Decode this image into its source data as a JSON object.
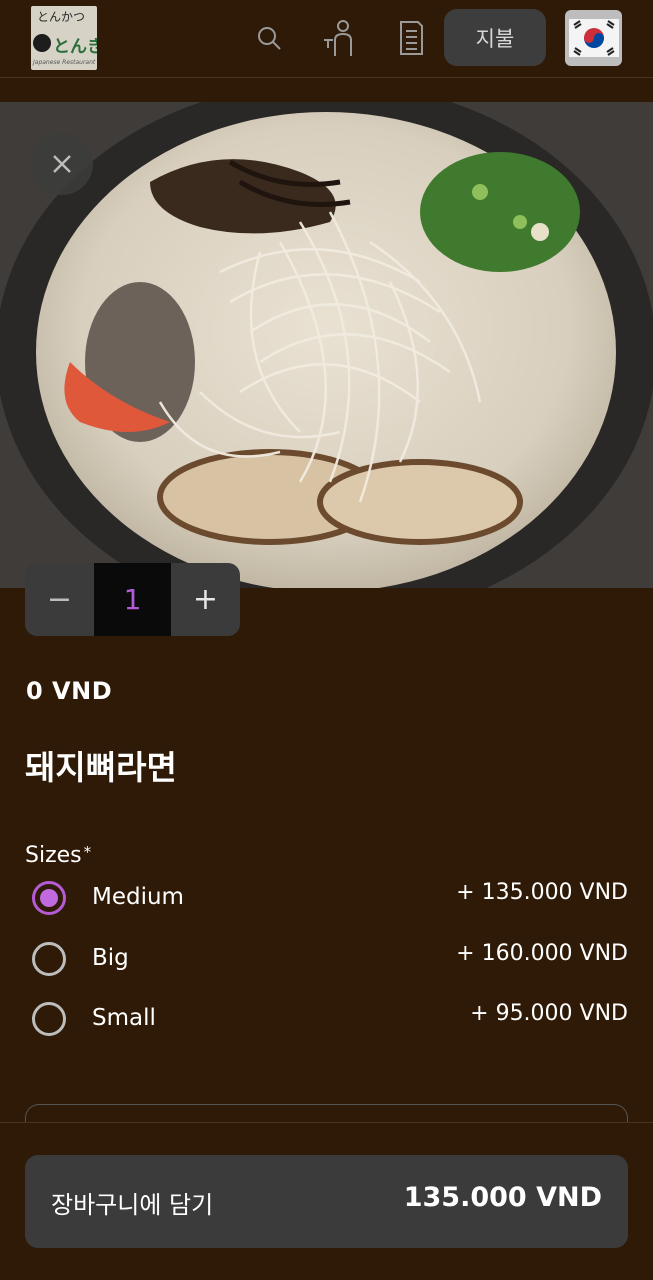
{
  "header": {
    "logo": {
      "top_text": "とんかつ",
      "mid_text": "とんき",
      "bottom_text": "Japanese Restaurant"
    },
    "pay_label": "지불",
    "icons": [
      "search-icon",
      "waiter-icon",
      "receipt-icon",
      "korea-flag-icon"
    ]
  },
  "product": {
    "quantity": "1",
    "minus_symbol": "−",
    "plus_symbol": "+",
    "base_price": "0 VND",
    "name": "돼지뼈라면"
  },
  "sizes": {
    "label": "Sizes",
    "required_marker": "*",
    "options": [
      {
        "label": "Medium",
        "price": "+ 135.000 VND",
        "selected": true
      },
      {
        "label": "Big",
        "price": "+ 160.000 VND",
        "selected": false
      },
      {
        "label": "Small",
        "price": "+ 95.000 VND",
        "selected": false
      }
    ]
  },
  "cart": {
    "label": "장바구니에 담기",
    "total": "135.000 VND"
  },
  "colors": {
    "background": "#2e1a06",
    "accent": "#b55bd6",
    "button": "#3b3b3b"
  }
}
